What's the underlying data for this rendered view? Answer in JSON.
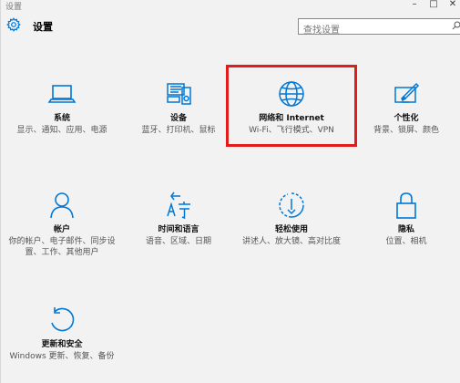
{
  "window": {
    "title": "设置",
    "controls": {
      "minimize": "–",
      "maximize": "□",
      "close": "✕"
    }
  },
  "header": {
    "title": "设置",
    "icon": "gear-icon"
  },
  "search": {
    "placeholder": "查找设置",
    "icon": "search-icon"
  },
  "accent_color": "#0078d7",
  "highlight_color": "#e21b1b",
  "tiles": [
    {
      "name": "系统",
      "desc": "显示、通知、应用、电源",
      "icon": "laptop-icon"
    },
    {
      "name": "设备",
      "desc": "蓝牙、打印机、鼠标",
      "icon": "devices-icon"
    },
    {
      "name": "网络和 Internet",
      "desc": "Wi-Fi、飞行模式、VPN",
      "icon": "globe-icon",
      "highlighted": true
    },
    {
      "name": "个性化",
      "desc": "背景、锁屏、颜色",
      "icon": "paint-icon"
    },
    {
      "name": "帐户",
      "desc": "你的帐户、电子邮件、同步设置、工作、其他用户",
      "icon": "person-icon"
    },
    {
      "name": "时间和语言",
      "desc": "语音、区域、日期",
      "icon": "time-language-icon"
    },
    {
      "name": "轻松使用",
      "desc": "讲述人、放大镜、高对比度",
      "icon": "ease-of-access-icon"
    },
    {
      "name": "隐私",
      "desc": "位置、相机",
      "icon": "lock-icon"
    },
    {
      "name": "更新和安全",
      "desc": "Windows 更新、恢复、备份",
      "icon": "update-icon"
    }
  ]
}
